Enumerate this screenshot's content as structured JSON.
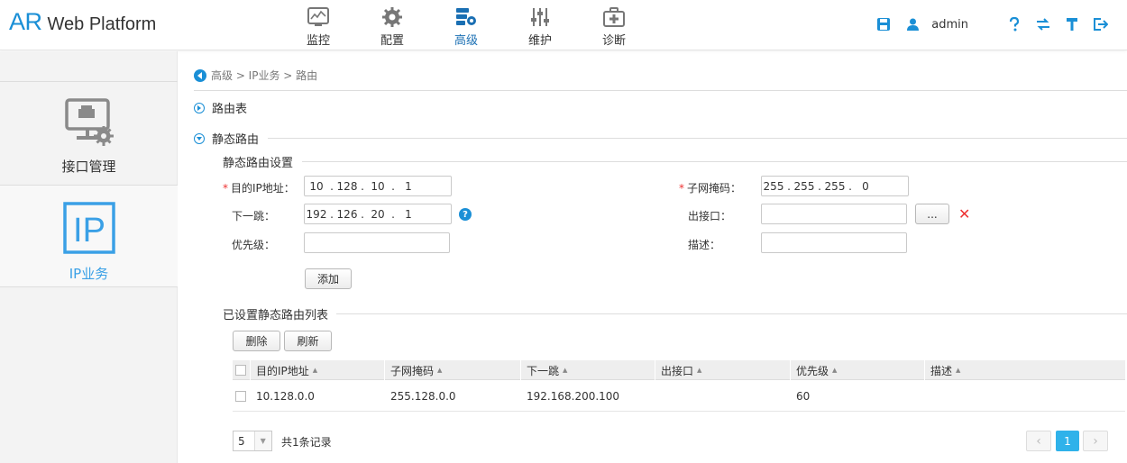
{
  "header": {
    "logo_ar": "AR",
    "logo_text": "Web Platform",
    "nav": [
      {
        "label": "监控",
        "icon": "monitor-icon"
      },
      {
        "label": "配置",
        "icon": "gear-icon"
      },
      {
        "label": "高级",
        "icon": "advanced-icon"
      },
      {
        "label": "维护",
        "icon": "sliders-icon"
      },
      {
        "label": "诊断",
        "icon": "medkit-icon"
      }
    ],
    "active_nav": "高级",
    "user": "admin"
  },
  "sidebar": {
    "items": [
      {
        "label": "接口管理",
        "icon": "interface-management-icon"
      },
      {
        "label": "IP业务",
        "icon": "ip-icon",
        "icon_text": "IP"
      }
    ],
    "active": "IP业务"
  },
  "breadcrumb": "高级 > IP业务 > 路由",
  "sections": {
    "route_table": "路由表",
    "static_route": "静态路由"
  },
  "form": {
    "title": "静态路由设置",
    "dest_ip_label": "目的IP地址：",
    "dest_ip": [
      "10",
      "128",
      "10",
      "1"
    ],
    "mask_label": "子网掩码：",
    "mask": [
      "255",
      "255",
      "255",
      "0"
    ],
    "next_hop_label": "下一跳：",
    "next_hop": [
      "192",
      "126",
      "20",
      "1"
    ],
    "out_if_label": "出接口：",
    "out_if_value": "",
    "browse_label": "...",
    "priority_label": "优先级：",
    "priority_value": "",
    "desc_label": "描述：",
    "desc_value": "",
    "add_label": "添加",
    "ip_dot": "."
  },
  "list": {
    "title": "已设置静态路由列表",
    "delete_label": "删除",
    "refresh_label": "刷新",
    "columns": [
      "目的IP地址",
      "子网掩码",
      "下一跳",
      "出接口",
      "优先级",
      "描述"
    ],
    "rows": [
      {
        "dest": "10.128.0.0",
        "mask": "255.128.0.0",
        "next_hop": "192.168.200.100",
        "out_if": "",
        "priority": "60",
        "desc": ""
      }
    ]
  },
  "pager": {
    "page_size": "5",
    "total": "共1条记录",
    "current_page": "1"
  },
  "colors": {
    "accent": "#1a8fd6",
    "active_page": "#2fb2ea",
    "required": "#e33333"
  }
}
